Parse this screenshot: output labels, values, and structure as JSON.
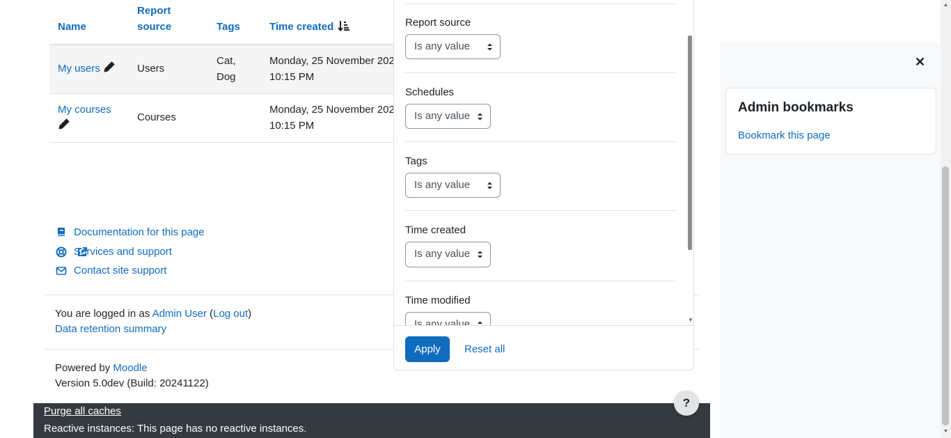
{
  "table": {
    "headers": {
      "name": "Name",
      "report_source_line1": "Report",
      "report_source_line2": "source",
      "tags": "Tags",
      "time_created": "Time created"
    },
    "rows": [
      {
        "name": "My users",
        "source": "Users",
        "tags_line1": "Cat,",
        "tags_line2": "Dog",
        "time_line1": "Monday, 25 November 202",
        "time_line2": "10:15 PM"
      },
      {
        "name": "My courses",
        "source": "Courses",
        "tags_line1": "",
        "tags_line2": "",
        "time_line1": "Monday, 25 November 202",
        "time_line2": "10:15 PM"
      }
    ]
  },
  "footer": {
    "docs_link": "Documentation for this page",
    "services_link": "Services and support",
    "contact_link": "Contact site support",
    "logged_in_prefix": "You are logged in as ",
    "user_name": "Admin User",
    "open_paren": " (",
    "logout": "Log out",
    "close_paren": ")",
    "data_retention": "Data retention summary",
    "powered_prefix": "Powered by ",
    "moodle": "Moodle",
    "version": "Version 5.0dev (Build: 20241122)"
  },
  "dev_bar": {
    "purge": "Purge all caches",
    "reactive": "Reactive instances: This page has no reactive instances."
  },
  "help_button": "?",
  "filters": {
    "items": [
      {
        "label": "Report source",
        "value": "Is any value"
      },
      {
        "label": "Schedules",
        "value": "Is any value"
      },
      {
        "label": "Tags",
        "value": "Is any value"
      },
      {
        "label": "Time created",
        "value": "Is any value"
      },
      {
        "label": "Time modified",
        "value": "Is any value"
      }
    ],
    "apply": "Apply",
    "reset": "Reset all"
  },
  "drawer": {
    "close": "✕",
    "block_title": "Admin bookmarks",
    "bookmark_link": "Bookmark this page"
  },
  "colors": {
    "link": "#0f6cbf",
    "primary_button": "#0f6cbf",
    "dev_bar": "#343a40"
  }
}
